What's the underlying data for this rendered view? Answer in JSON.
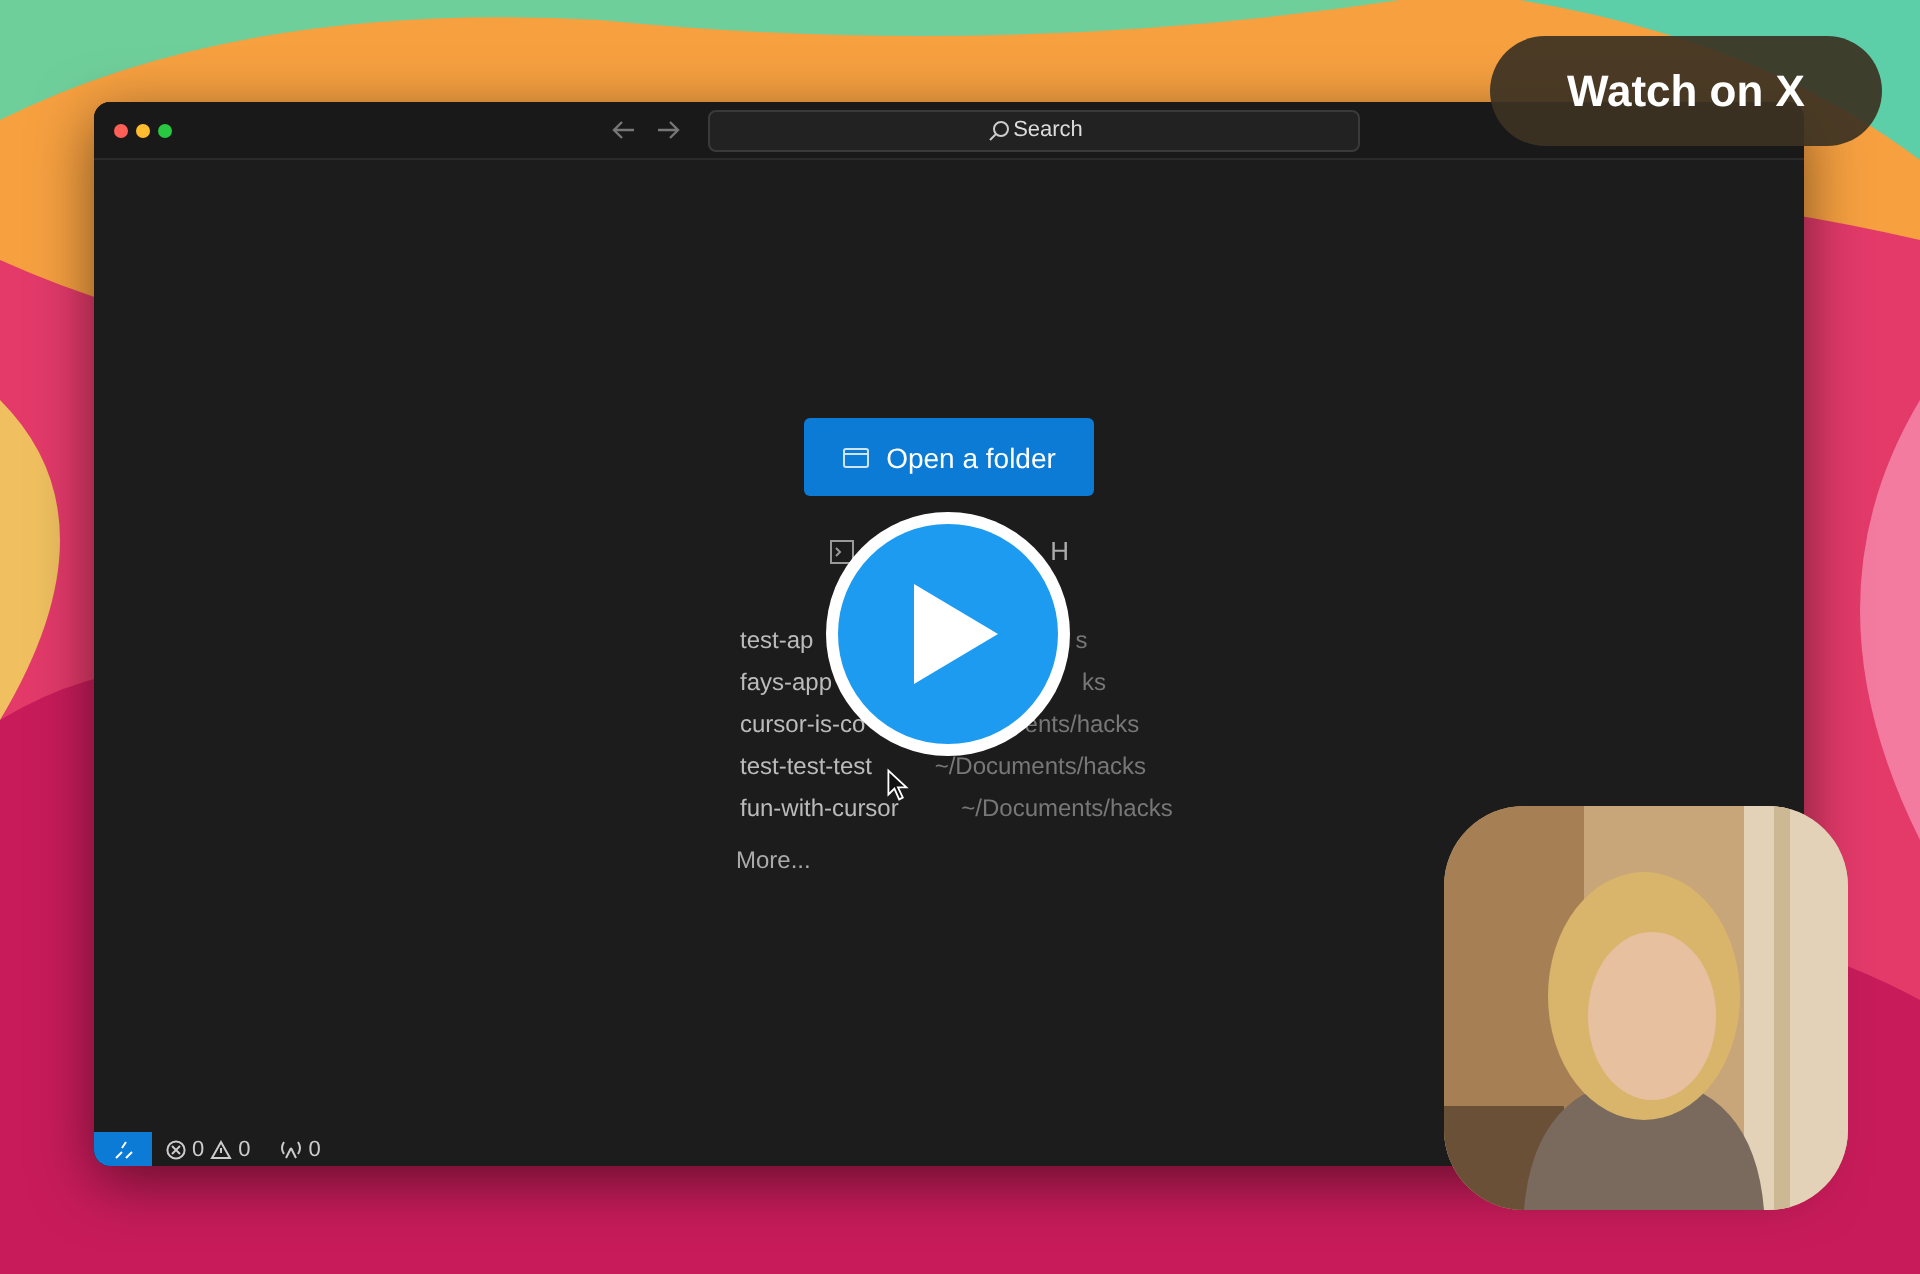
{
  "window": {
    "search": {
      "placeholder": "Search"
    },
    "open_button": {
      "label": "Open a folder"
    },
    "ssh": {
      "label": "H"
    },
    "recents": [
      {
        "name": "test-ap",
        "path": "s"
      },
      {
        "name": "fays-app",
        "path": "ks"
      },
      {
        "name": "cursor-is-co",
        "path": "ents/hacks"
      },
      {
        "name": "test-test-test",
        "path": "~/Documents/hacks"
      },
      {
        "name": "fun-with-cursor",
        "path": "~/Documents/hacks"
      }
    ],
    "more": "More...",
    "status_bar": {
      "errors": "0",
      "warnings": "0",
      "ports": "0"
    }
  },
  "watch_button": {
    "label": "Watch on X"
  }
}
